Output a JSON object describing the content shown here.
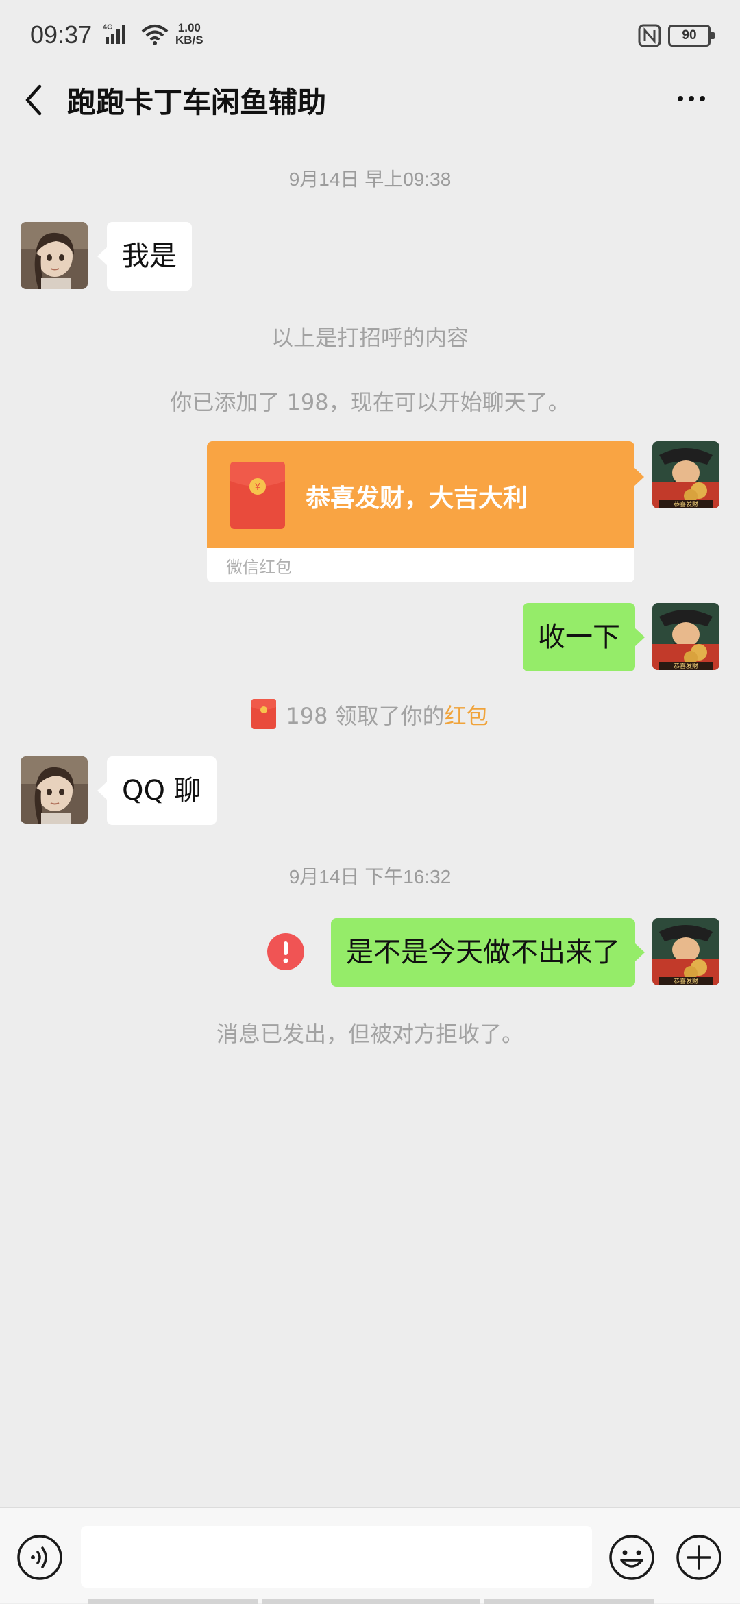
{
  "status_bar": {
    "time": "09:37",
    "network_type": "4G",
    "speed_value": "1.00",
    "speed_unit": "KB/S",
    "battery_level": "90"
  },
  "header": {
    "title": "跑跑卡丁车闲鱼辅助"
  },
  "chat": {
    "timestamp_1": "9月14日 早上09:38",
    "msg_1_text": "我是",
    "system_greeting": "以上是打招呼的内容",
    "system_added": "你已添加了 198，现在可以开始聊天了。",
    "red_packet": {
      "title": "恭喜发财，大吉大利",
      "label": "微信红包"
    },
    "msg_2_text": "收一下",
    "receipt_prefix": "198 领取了你的",
    "receipt_link": "红包",
    "msg_3_text": "QQ 聊",
    "timestamp_2": "9月14日 下午16:32",
    "msg_4_text": "是不是今天做不出来了",
    "rejected_notice": "消息已发出，但被对方拒收了。"
  },
  "input_bar": {
    "message_value": ""
  },
  "colors": {
    "background": "#ededed",
    "sent_bubble": "#95ec69",
    "received_bubble": "#ffffff",
    "red_packet_orange": "#f9a443",
    "error_red": "#f05454",
    "link_orange": "#f0a33a"
  },
  "icons": {
    "back": "chevron-left-icon",
    "more": "more-dots-icon",
    "voice": "voice-icon",
    "emoji": "emoji-icon",
    "plus": "plus-icon",
    "error": "error-icon"
  }
}
